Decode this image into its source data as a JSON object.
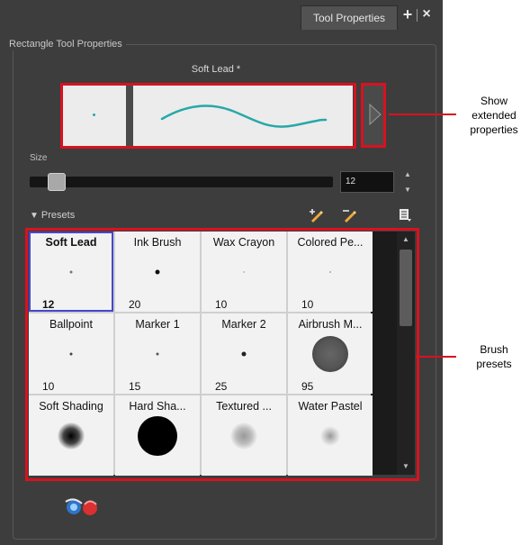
{
  "tab": {
    "title": "Tool Properties",
    "add_label": "+",
    "close_label": "×"
  },
  "group": {
    "title": "Rectangle Tool Properties"
  },
  "preset_name": "Soft Lead *",
  "size": {
    "label": "Size",
    "value": "12",
    "slider_level_pct": 9
  },
  "presets": {
    "label": "Presets",
    "items": [
      {
        "name": "Soft Lead",
        "size": "12",
        "selected": true
      },
      {
        "name": "Ink Brush",
        "size": "20"
      },
      {
        "name": "Wax Crayon",
        "size": "10"
      },
      {
        "name": "Colored Pe...",
        "size": "10"
      },
      {
        "name": "Ballpoint",
        "size": "10"
      },
      {
        "name": "Marker 1",
        "size": "15"
      },
      {
        "name": "Marker 2",
        "size": "25"
      },
      {
        "name": "Airbrush M...",
        "size": "95"
      },
      {
        "name": "Soft Shading",
        "size": ""
      },
      {
        "name": "Hard Sha...",
        "size": ""
      },
      {
        "name": "Textured ...",
        "size": ""
      },
      {
        "name": "Water Pastel",
        "size": ""
      }
    ]
  },
  "callouts": {
    "extended": "Show\nextended\nproperties",
    "brush": "Brush\npresets"
  },
  "colors": {
    "panel": "#3d3d3d",
    "highlight": "#d8121f",
    "selection": "#4646ce",
    "stroke": "#27a8a8"
  },
  "icons": [
    "plus-icon",
    "close-icon",
    "triangle-right-icon",
    "triangle-down-icon",
    "new-preset-icon",
    "rename-preset-icon",
    "menu-icon",
    "scroll-up-icon",
    "scroll-down-icon",
    "tool-option-a-icon",
    "tool-option-b-icon"
  ]
}
